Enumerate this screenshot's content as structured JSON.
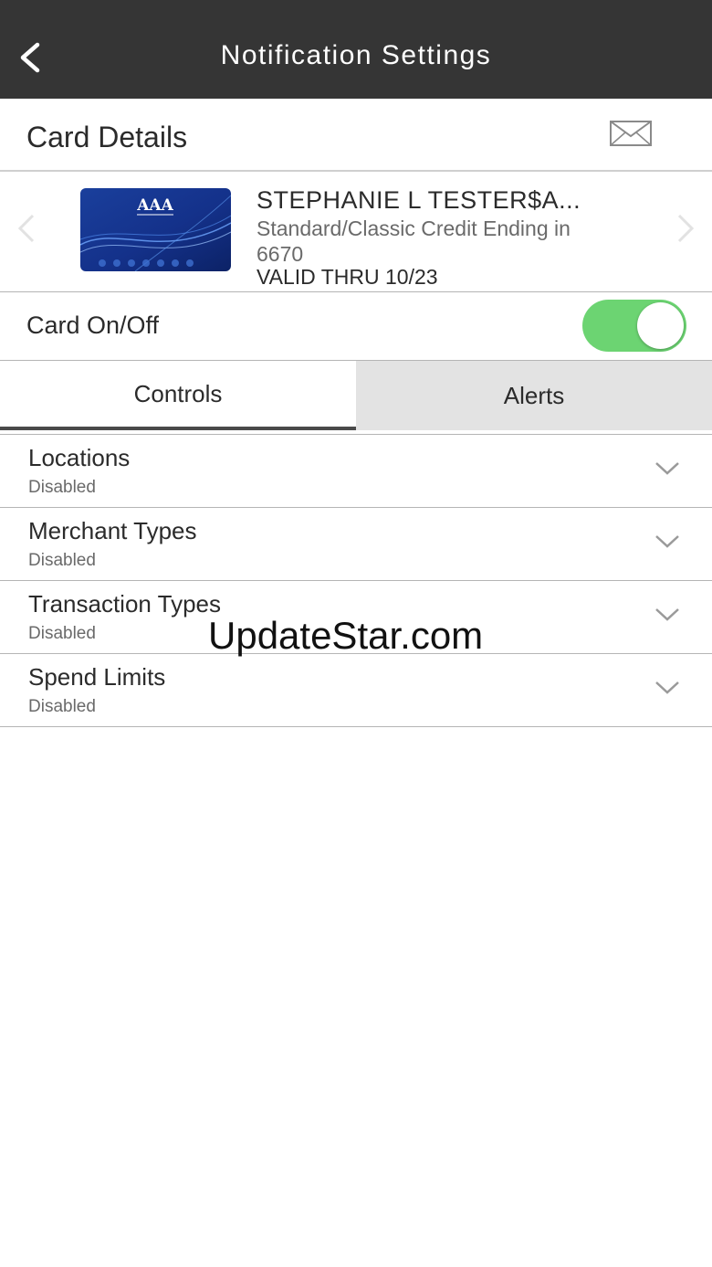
{
  "header": {
    "title": "Notification Settings"
  },
  "card_details": {
    "title": "Card Details"
  },
  "card": {
    "holder_name": "STEPHANIE L TESTER$A...",
    "type_line": "Standard/Classic Credit Ending in 6670",
    "valid_thru": "VALID THRU 10/23",
    "logo_text": "AAA"
  },
  "card_toggle": {
    "label": "Card On/Off",
    "on": true,
    "color": "#6cd472"
  },
  "tabs": [
    {
      "label": "Controls",
      "active": true
    },
    {
      "label": "Alerts",
      "active": false
    }
  ],
  "controls": [
    {
      "title": "Locations",
      "status": "Disabled"
    },
    {
      "title": "Merchant Types",
      "status": "Disabled"
    },
    {
      "title": "Transaction Types",
      "status": "Disabled"
    },
    {
      "title": "Spend Limits",
      "status": "Disabled"
    }
  ],
  "watermark": "UpdateStar.com"
}
